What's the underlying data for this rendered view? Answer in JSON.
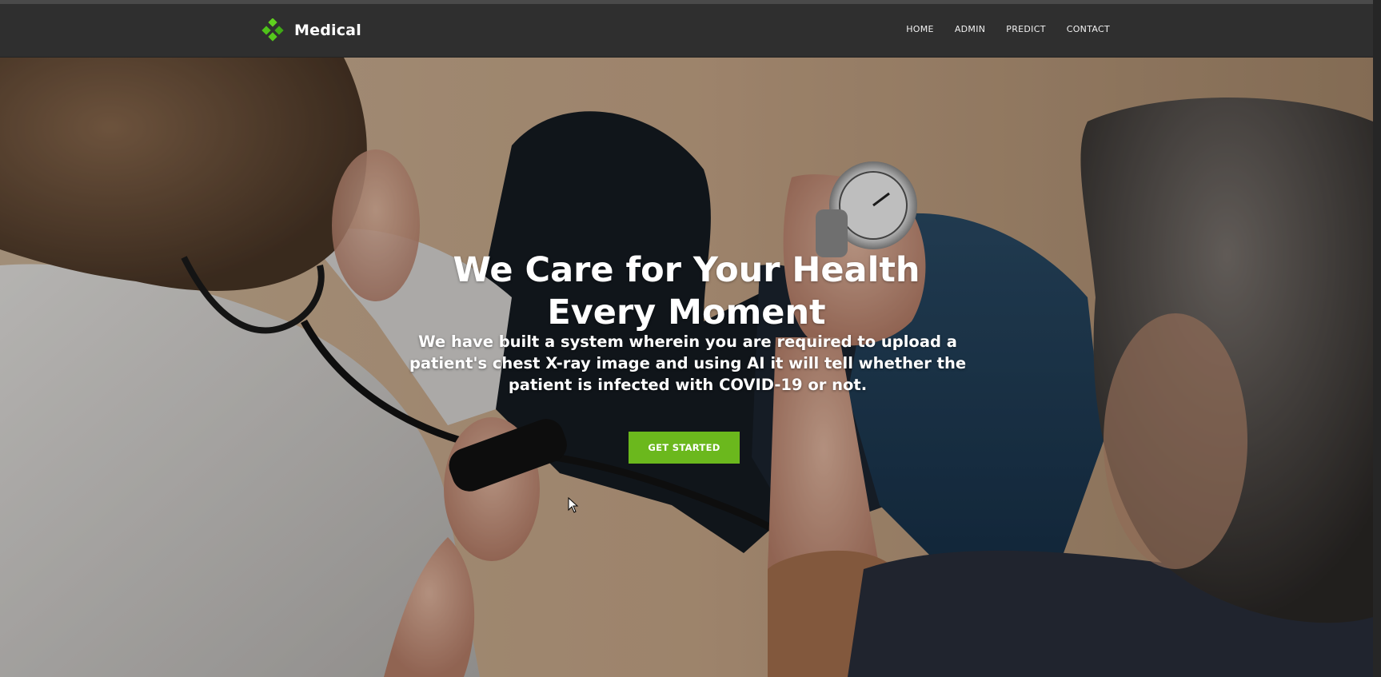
{
  "brand": {
    "name": "Medical",
    "logo_icon": "green-diamond-cluster-icon",
    "accent": "#4fc21a"
  },
  "nav": {
    "items": [
      {
        "label": "HOME"
      },
      {
        "label": "ADMIN"
      },
      {
        "label": "PREDICT"
      },
      {
        "label": "CONTACT"
      }
    ]
  },
  "hero": {
    "title_line1": "We Care for Your Health",
    "title_line2": "Every Moment",
    "subtitle": "We have built a system wherein you are required to upload a patient's chest X-ray image and using AI it will tell whether the patient is infected with COVID-19 or not.",
    "cta_label": "GET STARTED",
    "cta_color": "#6bb81d",
    "background_image": "doctor-measuring-blood-pressure-photo"
  },
  "colors": {
    "navbar": "#2f2f2f",
    "text": "#ffffff"
  }
}
